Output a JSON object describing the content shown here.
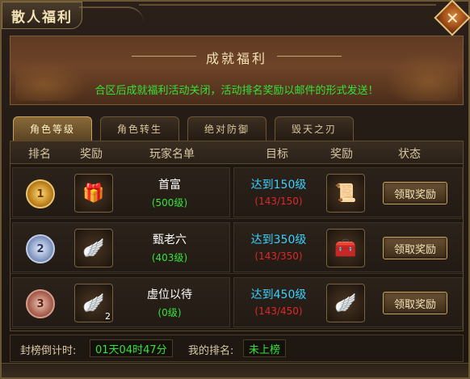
{
  "window": {
    "title": "散人福利"
  },
  "banner": {
    "title": "成就福利",
    "notice": "合区后成就福利活动关闭，活动排名奖励以邮件的形式发送！"
  },
  "tabs": [
    {
      "label": "角色等级",
      "active": true
    },
    {
      "label": "角色转生",
      "active": false
    },
    {
      "label": "绝对防御",
      "active": false
    },
    {
      "label": "毁天之刃",
      "active": false
    }
  ],
  "table": {
    "headers": {
      "rank": "排名",
      "reward": "奖励",
      "players": "玩家名单",
      "goal": "目标",
      "reward2": "奖励",
      "status": "状态"
    },
    "rows": [
      {
        "rank": "1",
        "reward_icon": "gift-box-icon",
        "player": "首富",
        "level": "(500级)",
        "goal": "达到150级",
        "progress": "(143/150)",
        "goal_reward_icon": "scroll-icon",
        "button": "领取奖励"
      },
      {
        "rank": "2",
        "reward_icon": "wings-icon",
        "player": "甄老六",
        "level": "(403级)",
        "goal": "达到350级",
        "progress": "(143/350)",
        "goal_reward_icon": "treasure-chest-icon",
        "button": "领取奖励"
      },
      {
        "rank": "3",
        "reward_icon": "wings-icon",
        "reward_qty": "2",
        "player": "虚位以待",
        "level": "(0级)",
        "goal": "达到450级",
        "progress": "(143/450)",
        "goal_reward_icon": "wings-icon",
        "button": "领取奖励"
      }
    ]
  },
  "footer": {
    "countdown_label": "封榜倒计时:",
    "countdown_value": "01天04时47分",
    "my_rank_label": "我的排名:",
    "my_rank_value": "未上榜"
  },
  "colors": {
    "accent_gold": "#c9a35c",
    "notice_green": "#31e23a",
    "goal_blue": "#3bd1ff",
    "progress_red": "#e0282a"
  }
}
